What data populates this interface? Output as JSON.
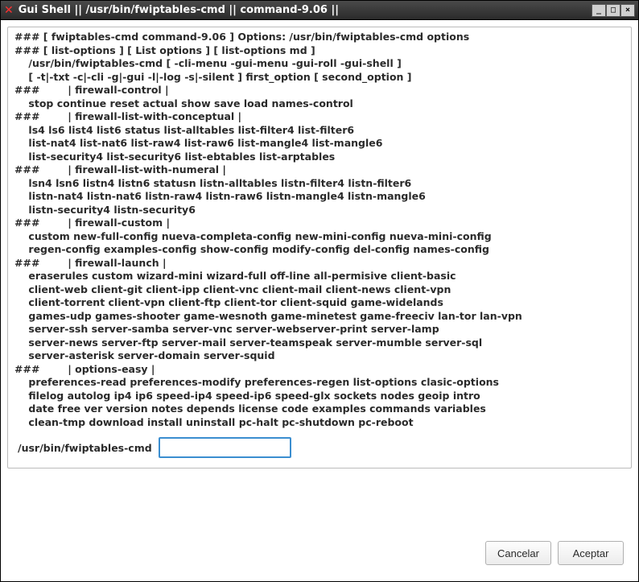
{
  "window": {
    "title": "Gui Shell || /usr/bin/fwiptables-cmd || command-9.06 ||"
  },
  "help": {
    "lines": [
      "### [ fwiptables-cmd command-9.06 ] Options: /usr/bin/fwiptables-cmd options",
      "### [ list-options ] [ List options ] [ list-options md ]",
      "    /usr/bin/fwiptables-cmd [ -cli-menu -gui-menu -gui-roll -gui-shell ]",
      "    [ -t|-txt -c|-cli -g|-gui -l|-log -s|-silent ] first_option [ second_option ]",
      "###        | firewall-control |",
      "    stop continue reset actual show save load names-control",
      "###        | firewall-list-with-conceptual |",
      "    ls4 ls6 list4 list6 status list-alltables list-filter4 list-filter6",
      "    list-nat4 list-nat6 list-raw4 list-raw6 list-mangle4 list-mangle6",
      "    list-security4 list-security6 list-ebtables list-arptables",
      "###        | firewall-list-with-numeral |",
      "    lsn4 lsn6 listn4 listn6 statusn listn-alltables listn-filter4 listn-filter6",
      "    listn-nat4 listn-nat6 listn-raw4 listn-raw6 listn-mangle4 listn-mangle6",
      "    listn-security4 listn-security6",
      "###        | firewall-custom |",
      "    custom new-full-config nueva-completa-config new-mini-config nueva-mini-config",
      "    regen-config examples-config show-config modify-config del-config names-config",
      "###        | firewall-launch |",
      "    eraserules custom wizard-mini wizard-full off-line all-permisive client-basic",
      "    client-web client-git client-ipp client-vnc client-mail client-news client-vpn",
      "    client-torrent client-vpn client-ftp client-tor client-squid game-widelands",
      "    games-udp games-shooter game-wesnoth game-minetest game-freeciv lan-tor lan-vpn",
      "    server-ssh server-samba server-vnc server-webserver-print server-lamp",
      "    server-news server-ftp server-mail server-teamspeak server-mumble server-sql",
      "    server-asterisk server-domain server-squid",
      "###        | options-easy |",
      "    preferences-read preferences-modify preferences-regen list-options clasic-options",
      "    filelog autolog ip4 ip6 speed-ip4 speed-ip6 speed-glx sockets nodes geoip intro",
      "    date free ver version notes depends license code examples commands variables",
      "    clean-tmp download install uninstall pc-halt pc-shutdown pc-reboot"
    ]
  },
  "input": {
    "label": "/usr/bin/fwiptables-cmd",
    "value": ""
  },
  "buttons": {
    "cancel": "Cancelar",
    "accept": "Aceptar"
  }
}
